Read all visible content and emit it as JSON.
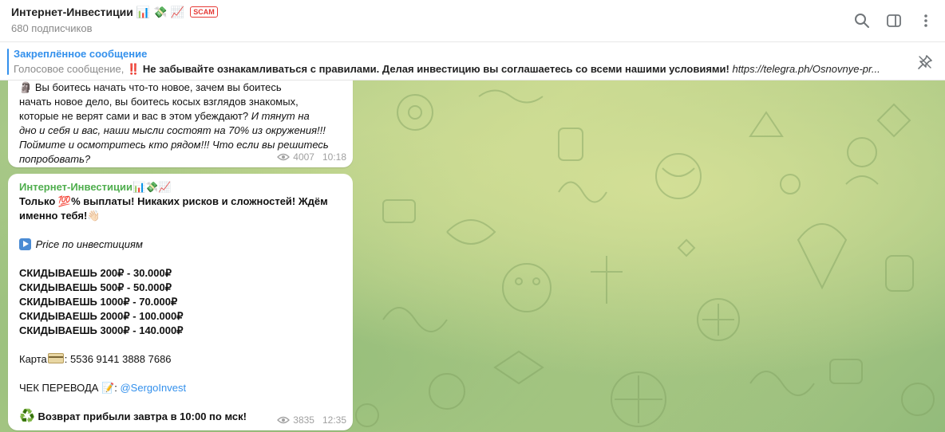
{
  "header": {
    "title": "Интернет-Инвестиции",
    "title_emojis": [
      "📊",
      "💸",
      "📈"
    ],
    "scam_badge": "SCAM",
    "subscribers": "680 подписчиков",
    "icons": [
      "search-icon",
      "sidebar-toggle-icon",
      "more-vertical-icon"
    ]
  },
  "pinned": {
    "label": "Закреплённое сообщение",
    "voice_prefix": "Голосовое сообщение,",
    "bang": "‼️",
    "text_bold": "Не забывайте ознакамливаться с правилами. Делая инвестицию вы соглашаетесь со всеми нашими условиями!",
    "link": "https://telegra.ph/Osnovnye-pr..."
  },
  "messages": [
    {
      "lead_emoji": "🗿",
      "line1": "Вы боитесь начать что-то новое, зачем вы боитесь",
      "line2": "начать новое дело, вы боитесь косых взглядов знакомых,",
      "line3_regular": "которые не верят сами и вас в этом убеждают?",
      "line3_italic": "И тянут на",
      "line4": "дно и себя и вас, наши мысли состоят на 70% из окружения!!!",
      "line5": "Поймите и осмотритесь кто рядом!!! Что если вы решитесь",
      "line6": "попробовать?",
      "views": "4007",
      "time": "10:18"
    },
    {
      "sender": "Интернет-Инвестиции📊💸📈",
      "intro_a": "Только 💯% выплаты! Никаких рисков и сложностей! Ждём",
      "intro_b": "именно тебя!👋🏻",
      "price_label": "Price по инвестициям",
      "prices": [
        "СКИДЫВАЕШЬ 200₽ - 30.000₽",
        "СКИДЫВАЕШЬ 500₽ - 50.000₽",
        "СКИДЫВАЕШЬ 1000₽ - 70.000₽",
        "СКИДЫВАЕШЬ 2000₽ - 100.000₽",
        "СКИДЫВАЕШЬ 3000₽ - 140.000₽"
      ],
      "card_label": "Карта",
      "card_number": ": 5536 9141 3888 7686",
      "receipt_label": "ЧЕК ПЕРЕВОДА",
      "receipt_emoji": "📝",
      "receipt_sep": ":",
      "receipt_handle": "@SergoInvest",
      "refund_emoji": "♻️",
      "refund_text": "Возврат прибыли завтра в 10:00 по мск!",
      "views": "3835",
      "time": "12:35"
    }
  ],
  "colors": {
    "accent": "#3390ec",
    "sender": "#4fae4e",
    "scam": "#e53935",
    "chat_bg": "#b5cf89"
  }
}
